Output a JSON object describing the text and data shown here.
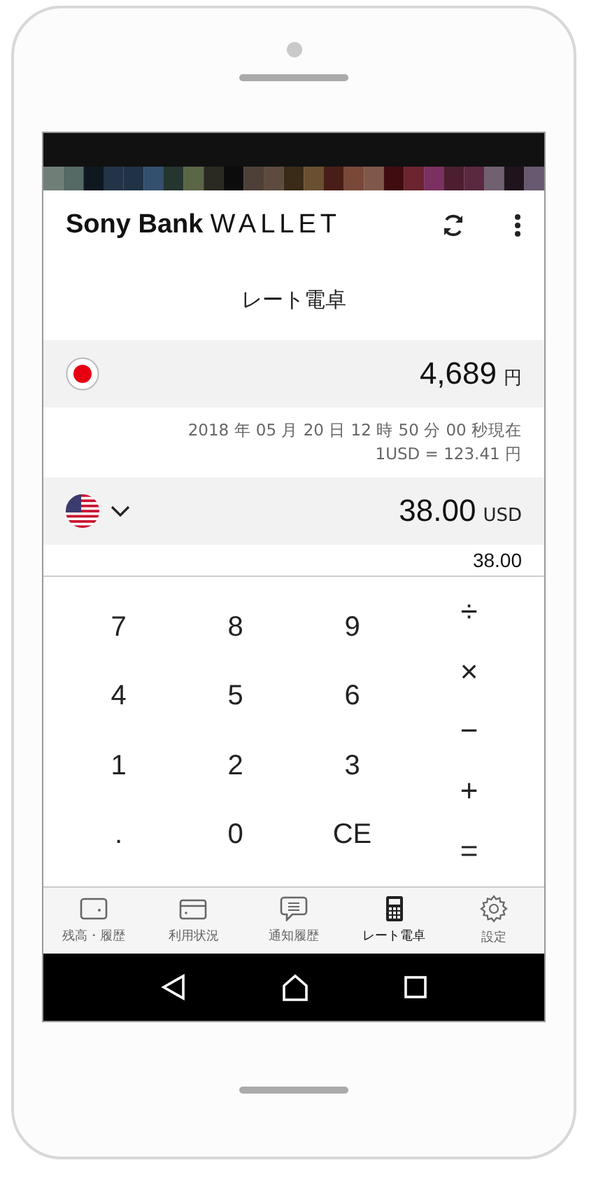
{
  "header": {
    "logo_bold": "Sony Bank",
    "logo_light": "WALLET"
  },
  "page_title": "レート電卓",
  "base_currency": {
    "kind": "japan",
    "amount": "4,689",
    "unit": "円"
  },
  "rate": {
    "timestamp": "2018 年 05 月 20 日 12 時 50 分 00 秒現在",
    "rate": "1USD = 123.41 円"
  },
  "target_currency": {
    "kind": "usa",
    "amount": "38.00",
    "unit": "USD"
  },
  "input_value": "38.00",
  "keypad": {
    "digits": [
      "7",
      "8",
      "9",
      "4",
      "5",
      "6",
      "1",
      "2",
      "3",
      ".",
      "0",
      "CE"
    ],
    "operators": [
      "÷",
      "×",
      "−",
      "+",
      "="
    ]
  },
  "tabs": [
    {
      "kind": "wallet",
      "label": "残高・履歴",
      "selected": false
    },
    {
      "kind": "card",
      "label": "利用状況",
      "selected": false
    },
    {
      "kind": "message",
      "label": "通知履歴",
      "selected": false
    },
    {
      "kind": "calculator",
      "label": "レート電卓",
      "selected": true
    },
    {
      "kind": "gear",
      "label": "設定",
      "selected": false
    }
  ]
}
